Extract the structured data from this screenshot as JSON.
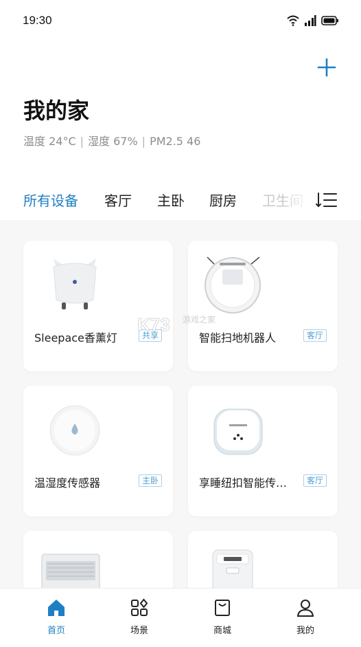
{
  "status_bar": {
    "time": "19:30"
  },
  "header": {
    "title": "我的家",
    "env": {
      "temperature": "温度 24°C",
      "humidity": "湿度 67%",
      "pm": "PM2.5  46",
      "separator": "|"
    }
  },
  "room_tabs": [
    "所有设备",
    "客厅",
    "主卧",
    "厨房",
    "卫生间"
  ],
  "devices": [
    {
      "name": "Sleepace香薰灯",
      "room": "共享"
    },
    {
      "name": "智能扫地机器人",
      "room": "客厅"
    },
    {
      "name": "温湿度传感器",
      "room": "主卧"
    },
    {
      "name": "享睡纽扣智能传感器",
      "room": "客厅"
    },
    {
      "name": "",
      "room": ""
    },
    {
      "name": "",
      "room": ""
    }
  ],
  "watermark": {
    "logo": "K73",
    "text": "游戏之家"
  },
  "bottom_nav": {
    "home": "首页",
    "scene": "场景",
    "mall": "商城",
    "mine": "我的"
  },
  "colors": {
    "accent": "#1f7ec4",
    "badge": "#4f9fd6"
  },
  "icons": {
    "add": "plus-icon",
    "sort": "sort-list-icon",
    "home": "home-icon",
    "scene": "scene-grid-icon",
    "mall": "shopping-bag-icon",
    "mine": "user-icon"
  }
}
